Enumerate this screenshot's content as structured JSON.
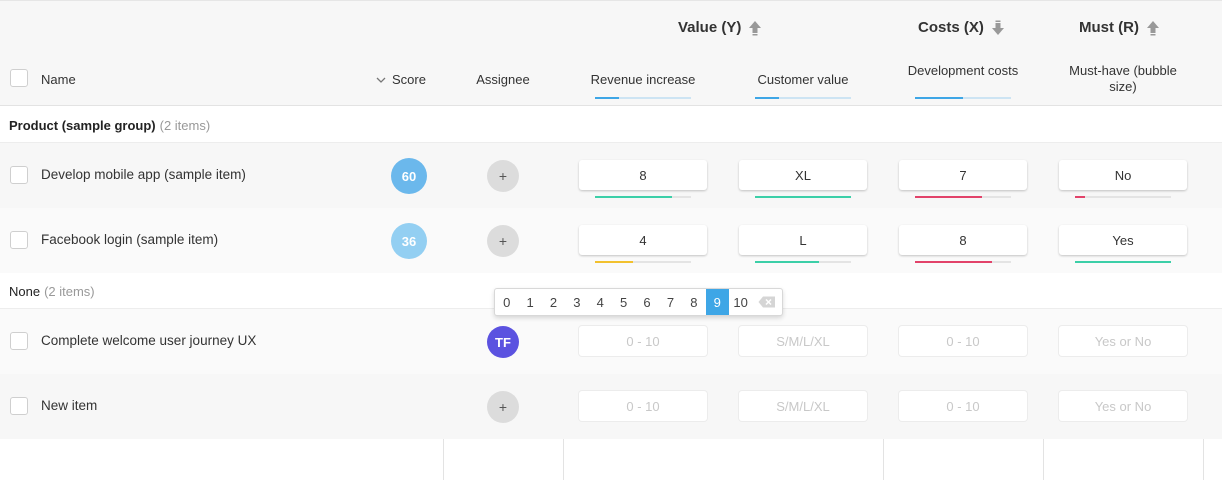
{
  "header": {
    "name_label": "Name",
    "score_label": "Score",
    "assignee_label": "Assignee",
    "groups": [
      {
        "title": "Value (Y)",
        "arrow": "arrow-up-icon"
      },
      {
        "title": "Costs (X)",
        "arrow": "arrow-down-icon"
      },
      {
        "title": "Must (R)",
        "arrow": "arrow-up-icon"
      }
    ],
    "criteria": [
      {
        "label": "Revenue increase",
        "weight": 0.25
      },
      {
        "label": "Customer value",
        "weight": 0.25
      },
      {
        "label": "Development costs",
        "weight": 0.5
      },
      {
        "label": "Must-have (bubble size)",
        "weight": 0
      }
    ]
  },
  "groups": [
    {
      "title": "Product (sample group)",
      "count": "(2 items)",
      "bold": true
    },
    {
      "title": "None",
      "count": "(2 items)",
      "bold": false
    }
  ],
  "items": [
    {
      "name": "Develop mobile app (sample item)",
      "score": "60",
      "score_color": "#6bb8ec",
      "assignee": "+",
      "values": [
        "8",
        "XL",
        "7",
        "No"
      ],
      "fills": [
        0.8,
        1.0,
        0.7,
        0.1
      ],
      "fill_colors": [
        "#3ccfa8",
        "#3ccfa8",
        "#e2436a",
        "#e2436a"
      ]
    },
    {
      "name": "Facebook login (sample item)",
      "score": "36",
      "score_color": "#93cff2",
      "assignee": "+",
      "values": [
        "4",
        "L",
        "8",
        "Yes"
      ],
      "fills": [
        0.4,
        0.67,
        0.8,
        1.0
      ],
      "fill_colors": [
        "#f2c12e",
        "#3ccfa8",
        "#e2436a",
        "#3ccfa8"
      ]
    },
    {
      "name": "Complete welcome user journey UX",
      "assignee_initials": "TF",
      "placeholders": [
        "0 - 10",
        "S/M/L/XL",
        "0 - 10",
        "Yes or No"
      ]
    },
    {
      "name": "New item",
      "assignee": "+",
      "placeholders": [
        "0 - 10",
        "S/M/L/XL",
        "0 - 10",
        "Yes or No"
      ]
    }
  ],
  "picker": {
    "options": [
      "0",
      "1",
      "2",
      "3",
      "4",
      "5",
      "6",
      "7",
      "8",
      "9",
      "10"
    ],
    "selected": "9",
    "clear_icon": "backspace-icon"
  },
  "colors": {
    "accent": "#3ea6e6",
    "avatar": "#5b52e0"
  }
}
